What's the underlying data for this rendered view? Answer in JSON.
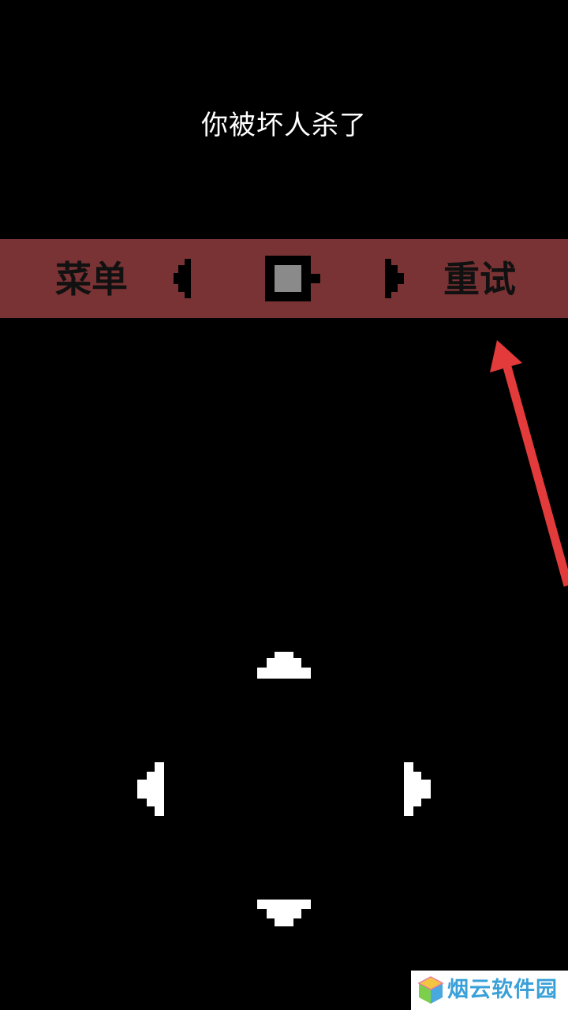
{
  "screen": {
    "message": "你被坏人杀了"
  },
  "menu_bar": {
    "menu_label": "菜单",
    "retry_label": "重试",
    "background_color": "#7a3334",
    "icons": {
      "prev": "triangle-left-icon",
      "next": "triangle-right-icon",
      "center": "battery-icon"
    }
  },
  "dpad": {
    "up": "triangle-up-icon",
    "down": "triangle-down-icon",
    "left": "triangle-left-icon",
    "right": "triangle-right-icon",
    "color": "#ffffff"
  },
  "annotation": {
    "color": "#e33b3b",
    "icon": "arrow-icon"
  },
  "watermark": {
    "text": "烟云软件园",
    "color": "#3aa0d8",
    "icon": "cube-logo-icon"
  }
}
